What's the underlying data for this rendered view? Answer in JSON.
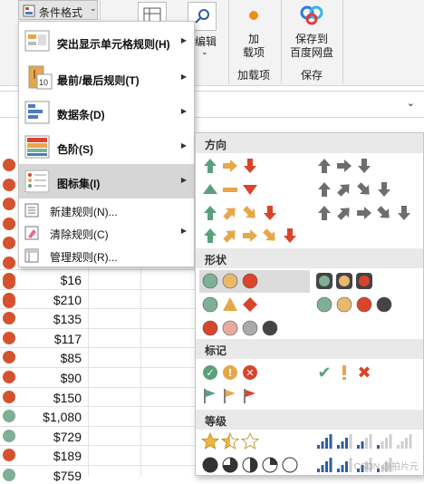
{
  "ribbon": {
    "cond_format": "条件格式",
    "load": "加\n载项",
    "load_group": "加载项",
    "save_baidu": "保存到\n百度网盘",
    "save_group": "保存",
    "edit_frag": "编辑"
  },
  "menu": {
    "items": [
      {
        "label": "突出显示单元格规则(H)",
        "bold": true,
        "arrow": "▶"
      },
      {
        "label": "最前/最后规则(T)",
        "bold": true,
        "arrow": "▶"
      },
      {
        "label": "数据条(D)",
        "bold": true,
        "arrow": "▶"
      },
      {
        "label": "色阶(S)",
        "bold": true,
        "arrow": "▶"
      },
      {
        "label": "图标集(I)",
        "bold": true,
        "arrow": "▶"
      },
      {
        "label": "新建规则(N)...",
        "bold": false,
        "arrow": ""
      },
      {
        "label": "清除规则(C)",
        "bold": false,
        "arrow": "▶"
      },
      {
        "label": "管理规则(R)...",
        "bold": false,
        "arrow": ""
      }
    ]
  },
  "submenu": {
    "sections": [
      "方向",
      "形状",
      "标记",
      "等级"
    ]
  },
  "sheet": {
    "values": [
      "$16",
      "$210",
      "$135",
      "$117",
      "$85",
      "$90",
      "$150",
      "$1,080",
      "$729",
      "$189",
      "$759"
    ],
    "dot_colors_top": [
      "#d4532f",
      "#d4532f",
      "#d4532f",
      "#d4532f",
      "#d4532f",
      "#d4532f",
      "#d4532f",
      "#d4532f",
      "#d4532f",
      "#d4532f",
      "#d4532f",
      "#d4532f",
      "#d4532f"
    ],
    "dot_colors": [
      "#d4532f",
      "#d4532f",
      "#d4532f",
      "#d4532f",
      "#d4532f",
      "#d4532f",
      "#d4532f",
      "#7faf95",
      "#7faf95",
      "#d4532f",
      "#7faf95"
    ]
  },
  "colors": {
    "green": "#5aa07c",
    "yellow": "#e8a64a",
    "red": "#d9442a",
    "gray": "#6e6e6e"
  },
  "watermark": "CSDN @拍片元"
}
